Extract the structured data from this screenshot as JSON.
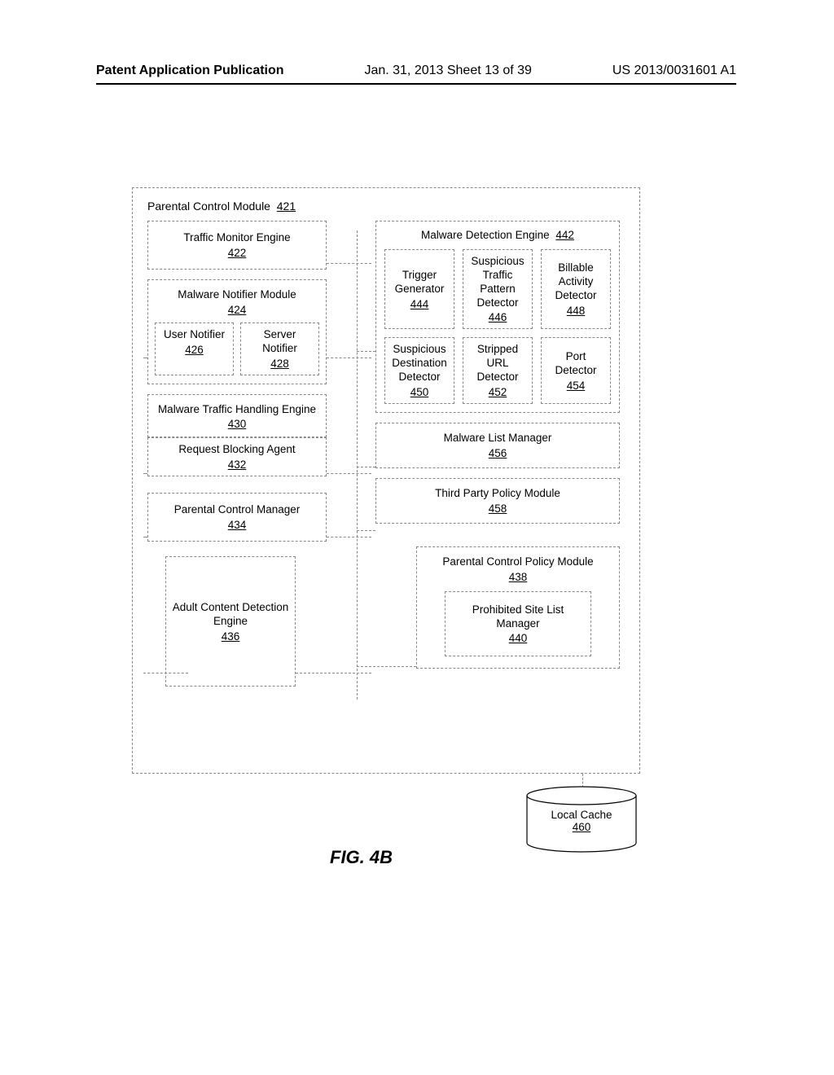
{
  "header": {
    "left": "Patent Application Publication",
    "center": "Jan. 31, 2013  Sheet 13 of 39",
    "right": "US 2013/0031601 A1"
  },
  "figure_caption": "FIG. 4B",
  "module": {
    "title": "Parental Control Module",
    "num": "421",
    "left": {
      "traffic_monitor": {
        "label": "Traffic Monitor Engine",
        "num": "422"
      },
      "mal_notifier": {
        "label": "Malware Notifier Module",
        "num": "424",
        "user": {
          "label": "User Notifier",
          "num": "426"
        },
        "server": {
          "label": "Server Notifier",
          "num": "428"
        }
      },
      "mal_traffic": {
        "label": "Malware Traffic Handling Engine",
        "num": "430"
      },
      "req_block": {
        "label": "Request Blocking Agent",
        "num": "432"
      },
      "pc_manager": {
        "label": "Parental Control Manager",
        "num": "434"
      },
      "adult_engine": {
        "label": "Adult Content Detection Engine",
        "num": "436"
      }
    },
    "right": {
      "mal_detect": {
        "label": "Malware Detection Engine",
        "num": "442",
        "cells": [
          {
            "label": "Trigger Generator",
            "num": "444"
          },
          {
            "label": "Suspicious Traffic Pattern Detector",
            "num": "446"
          },
          {
            "label": "Billable Activity Detector",
            "num": "448"
          },
          {
            "label": "Suspicious Destination Detector",
            "num": "450"
          },
          {
            "label": "Stripped URL Detector",
            "num": "452"
          },
          {
            "label": "Port Detector",
            "num": "454"
          }
        ]
      },
      "mal_list": {
        "label": "Malware List Manager",
        "num": "456"
      },
      "third_party": {
        "label": "Third Party Policy Module",
        "num": "458"
      },
      "pc_policy": {
        "label": "Parental Control Policy Module",
        "num": "438",
        "inner": {
          "label": "Prohibited Site List Manager",
          "num": "440"
        }
      }
    }
  },
  "cache": {
    "label": "Local Cache",
    "num": "460"
  }
}
